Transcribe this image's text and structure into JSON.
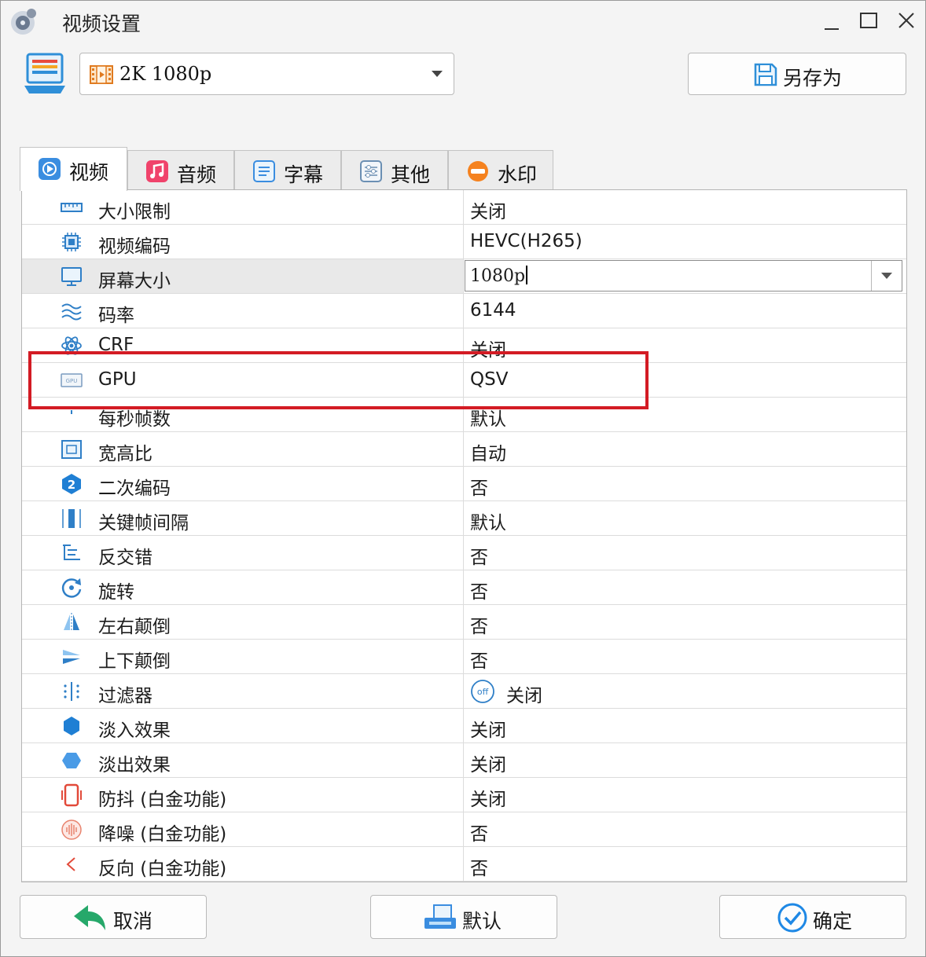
{
  "window": {
    "title": "视频设置"
  },
  "preset": {
    "value": "2K  1080p"
  },
  "save_as": {
    "label": "另存为"
  },
  "tabs": [
    {
      "label": "视频",
      "icon": "video-tab-icon",
      "active": true
    },
    {
      "label": "音频",
      "icon": "music-note-icon"
    },
    {
      "label": "字幕",
      "icon": "subtitle-icon"
    },
    {
      "label": "其他",
      "icon": "sliders-icon"
    },
    {
      "label": "水印",
      "icon": "watermark-icon"
    }
  ],
  "settings": [
    {
      "label": "大小限制",
      "value": "关闭",
      "icon": "ruler-icon"
    },
    {
      "label": "视频编码",
      "value": "HEVC(H265)",
      "icon": "chip-icon"
    },
    {
      "label": "屏幕大小",
      "value": "1080p",
      "icon": "monitor-icon",
      "editing": true
    },
    {
      "label": "码率",
      "value": "6144",
      "icon": "waves-icon"
    },
    {
      "label": "CRF",
      "value": "关闭",
      "icon": "atom-icon"
    },
    {
      "label": "GPU",
      "value": "QSV",
      "icon": "gpu-icon"
    },
    {
      "label": "每秒帧数",
      "value": "默认",
      "icon": "fps-icon"
    },
    {
      "label": "宽高比",
      "value": "自动",
      "icon": "aspect-ratio-icon"
    },
    {
      "label": "二次编码",
      "value": "否",
      "icon": "two-pass-icon"
    },
    {
      "label": "关键帧间隔",
      "value": "默认",
      "icon": "keyframe-icon"
    },
    {
      "label": "反交错",
      "value": "否",
      "icon": "deinterlace-icon"
    },
    {
      "label": "旋转",
      "value": "否",
      "icon": "rotate-icon"
    },
    {
      "label": "左右颠倒",
      "value": "否",
      "icon": "flip-horizontal-icon"
    },
    {
      "label": "上下颠倒",
      "value": "否",
      "icon": "flip-vertical-icon"
    },
    {
      "label": "过滤器",
      "value": "关闭",
      "icon": "filter-icon",
      "badge": "off"
    },
    {
      "label": "淡入效果",
      "value": "关闭",
      "icon": "fade-in-icon"
    },
    {
      "label": "淡出效果",
      "value": "关闭",
      "icon": "fade-out-icon"
    },
    {
      "label": "防抖 (白金功能)",
      "value": "关闭",
      "icon": "stabilize-icon"
    },
    {
      "label": "降噪 (白金功能)",
      "value": "否",
      "icon": "denoise-icon"
    },
    {
      "label": "反向 (白金功能)",
      "value": "否",
      "icon": "reverse-icon"
    }
  ],
  "highlighted_row": "GPU",
  "buttons": {
    "cancel": "取消",
    "default": "默认",
    "ok": "确定"
  },
  "colors": {
    "highlight": "#d31b24",
    "accent_blue": "#1e88e5"
  }
}
